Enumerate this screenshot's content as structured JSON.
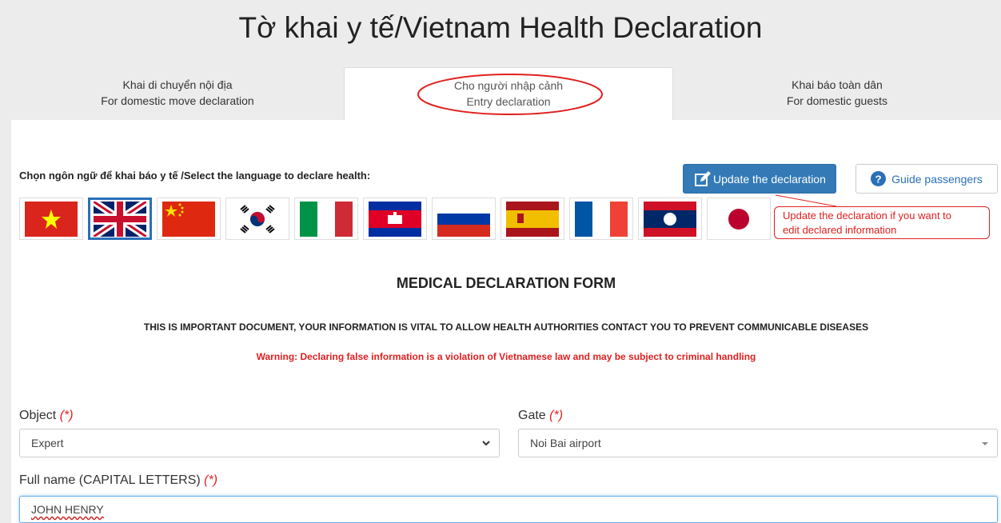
{
  "page_title": "Tờ khai y tế/Vietnam Health Declaration",
  "tabs": [
    {
      "line1": "Khai di chuyển nội địa",
      "line2": "For domestic move declaration"
    },
    {
      "line1": "Cho người nhập cảnh",
      "line2": "Entry declaration",
      "active": true
    },
    {
      "line1": "Khai báo toàn dân",
      "line2": "For domestic guests"
    }
  ],
  "language_label": "Chọn ngôn ngữ để khai báo y tế /Select the language to declare health:",
  "buttons": {
    "update": "Update the declaration",
    "guide": "Guide passengers"
  },
  "flags": [
    "vietnam",
    "united-kingdom",
    "china",
    "south-korea",
    "italy",
    "cambodia",
    "russia",
    "spain",
    "france",
    "laos",
    "japan"
  ],
  "selected_flag": "united-kingdom",
  "callout": {
    "line1": "Update the declaration if you want to",
    "line2": "edit declared information"
  },
  "form": {
    "heading": "MEDICAL DECLARATION FORM",
    "note": "THIS IS IMPORTANT DOCUMENT, YOUR INFORMATION IS VITAL TO ALLOW HEALTH AUTHORITIES CONTACT YOU TO PREVENT COMMUNICABLE DISEASES",
    "warning": "Warning: Declaring false information is a violation of Vietnamese law and may be subject to criminal handling",
    "required_mark": "(*)",
    "object_label": "Object",
    "object_value": "Expert",
    "gate_label": "Gate",
    "gate_value": "Noi Bai airport",
    "fullname_label": "Full name (CAPITAL LETTERS)",
    "fullname_value": "JOHN HENRY"
  },
  "colors": {
    "primary": "#337ab7",
    "annotation_red": "#e02020",
    "warning_red": "#e02020"
  }
}
